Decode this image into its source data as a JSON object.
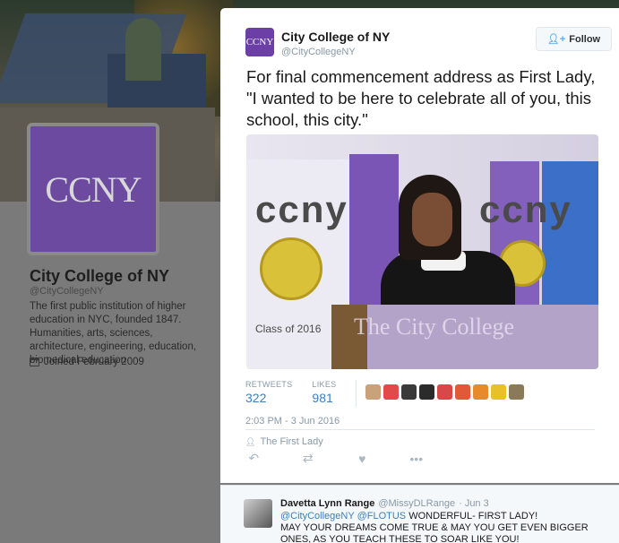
{
  "profile": {
    "avatar_text": "CCNY",
    "name": "City College of NY",
    "handle": "@CityCollegeNY",
    "bio": "The first public institution of higher education in NYC, founded 1847. Humanities, arts, sciences, architecture, engineering, education, biomedical education",
    "joined": "Joined February 2009"
  },
  "tweet": {
    "avatar_text": "CCNY",
    "name": "City College of NY",
    "handle": "@CityCollegeNY",
    "follow_label": "Follow",
    "text": "For final commencement address as First Lady, \"I wanted to be here to celebrate all of you, this school, this city.\"",
    "photo": {
      "banner_text_left": "ccny",
      "banner_text_right": "ccny",
      "podium_text": "The City College",
      "sign_text": "Class of 2016"
    },
    "retweets_label": "RETWEETS",
    "retweets": "322",
    "likes_label": "LIKES",
    "likes": "981",
    "timestamp": "2:03 PM - 3 Jun 2016",
    "location": "The First Lady",
    "liker_colors": [
      "#c9a27a",
      "#e04a4a",
      "#3a3a3a",
      "#2b2b2b",
      "#d84848",
      "#e05a3a",
      "#e88a2a",
      "#e8c02a",
      "#8a7a5a"
    ]
  },
  "reply": {
    "name": "Davetta Lynn Range",
    "handle": "@MissyDLRange",
    "date": "· Jun 3",
    "mention1": "@CityCollegeNY",
    "mention2": "@FLOTUS",
    "text_after_mentions": "WONDERFUL- FIRST LADY!",
    "text_rest": "MAY YOUR DREAMS COME TRUE & MAY YOU GET EVEN BIGGER ONES, AS YOU TEACH THESE TO SOAR LIKE YOU!"
  }
}
